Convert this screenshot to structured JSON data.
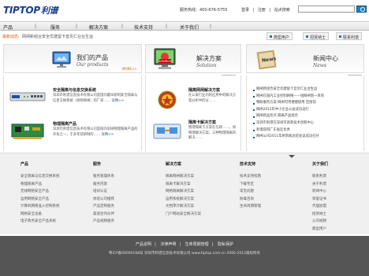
{
  "header": {
    "logo_en": "TIPTOP",
    "logo_cn": "利谱",
    "hotline": "服务热线：400-676-5755",
    "links": [
      "登录",
      "注册",
      "站点搜索"
    ],
    "search_placeholder": ""
  },
  "nav": [
    "产品",
    "服务",
    "解决方案",
    "技术支持",
    "关于我们"
  ],
  "newsbar": {
    "label": "最新动态:",
    "text": "网闸新组合安全优建留卡音页仁业台生运",
    "tabs": [
      "典型用户",
      "招贤纳士",
      "联系利谱"
    ]
  },
  "banners": {
    "products": {
      "title": "我们的产品",
      "sub": "Our products",
      "more": "MORE>>"
    },
    "solution": {
      "title": "解决方案",
      "sub": "Solution",
      "more": "MORE>>"
    },
    "news": {
      "title": "新闻中心",
      "sub": "News",
      "more": "MORE>>"
    }
  },
  "products": [
    {
      "title": "安全隔离与信息交换系统",
      "desc": "深圳市利谱信息技术有限公司是国内最早研制安全隔离与信息交换系统（俗称网闸）的厂家……",
      "link": "详情>>"
    },
    {
      "title": "物理隔离产品",
      "desc": "深圳市利谱信息技术有限公司是国内早研物理隔离产品的开发之一，于多年前研制的……",
      "link": "详情>>"
    }
  ],
  "solutions": [
    {
      "title": "隔离网闸解决方案",
      "desc": "在公安行业内的应用中的解决方案分析中的分……"
    },
    {
      "title": "隔离卡解决方案",
      "desc": "物理隔离卡方案在在政……，如物理解决方案，三种物理隔离的解决……"
    }
  ],
  "news": [
    "网闸新组合安全优建留卡音页仁业台生运",
    "网闸在国内工业控制网络——组网闸到一目的",
    "物联服务方案 网闸可用便捷接用 连接前",
    "网闸2012年中小企业公益成功运行",
    "网闸新品亮点 隔离产品组合",
    "深圳市利谱在深圳市高新技术创新中心",
    "利谱获得广东省区优秀",
    "网闸公司2011年终新闻总结会议成功召开"
  ],
  "footer": {
    "columns": [
      {
        "title": "产品",
        "items": [
          "安全隔离与信息交换系统",
          "物理隔离产品",
          "无线网络安全产品",
          "运用网络安全产品",
          "计算机网络准入控制系统",
          "网络安全设备",
          "电子政务安全产品系统"
        ]
      },
      {
        "title": "服务",
        "items": [
          "服务管理体系",
          "服务内容",
          "培训认证",
          "体验公司推荐",
          "产品定制服务",
          "渠道合作伙伴",
          "产品视频服务"
        ]
      },
      {
        "title": "解决方案",
        "items": [
          "隔离网闸解决方案",
          "隔离卡解决方案",
          "网络隔离解决方案",
          "运用系统解决方案",
          "文档审计解决方案",
          "门户网站安全解决方案"
        ]
      },
      {
        "title": "技术支持",
        "items": [
          "技术支持指南",
          "下载专区",
          "常见问题",
          "防毒咨询",
          "生命周期管理"
        ]
      },
      {
        "title": "关于我们",
        "items": [
          "联系利谱",
          "关于利谱",
          "新闻中心",
          "荣誉证书",
          "代理加盟",
          "招贤纳士",
          "公司视频",
          "典型用户"
        ]
      }
    ]
  },
  "bottom": {
    "links": [
      "产品说明",
      "法律声明",
      "生命周期管理",
      "隐私保护"
    ],
    "copyright": "粤ICP备09000168号  深圳市利谱信息技术有限公司  www.tiptop.com.cn  2000-2012版权所有"
  },
  "colors": {
    "brand": "#1a3d8c",
    "accent": "#e05a00",
    "link": "#1a50a0",
    "footer_bg": "#555555"
  }
}
